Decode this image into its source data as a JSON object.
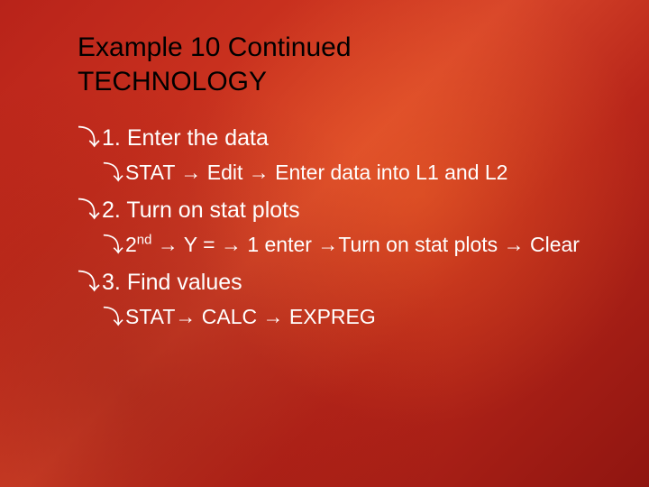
{
  "title_line1": "Example 10 Continued",
  "title_line2": "TECHNOLOGY",
  "bullet_glyph": "⤵",
  "arrow_glyph": "→",
  "steps": [
    {
      "head_num": "1.",
      "head_text": "Enter the data",
      "sub_segments": [
        "STAT ",
        "→",
        " Edit ",
        "→",
        " Enter data into L1 and L2"
      ]
    },
    {
      "head_num": "2.",
      "head_text": "Turn on stat plots",
      "sub_segments": [
        "2",
        "nd_sup",
        " ",
        "→",
        " Y = ",
        "→",
        " 1 enter ",
        "→",
        "Turn on stat plots ",
        "→",
        " Clear"
      ]
    },
    {
      "head_num": "3.",
      "head_text": "Find values",
      "sub_segments": [
        "STAT",
        "→",
        " CALC ",
        "→",
        " EXPREG"
      ]
    }
  ]
}
